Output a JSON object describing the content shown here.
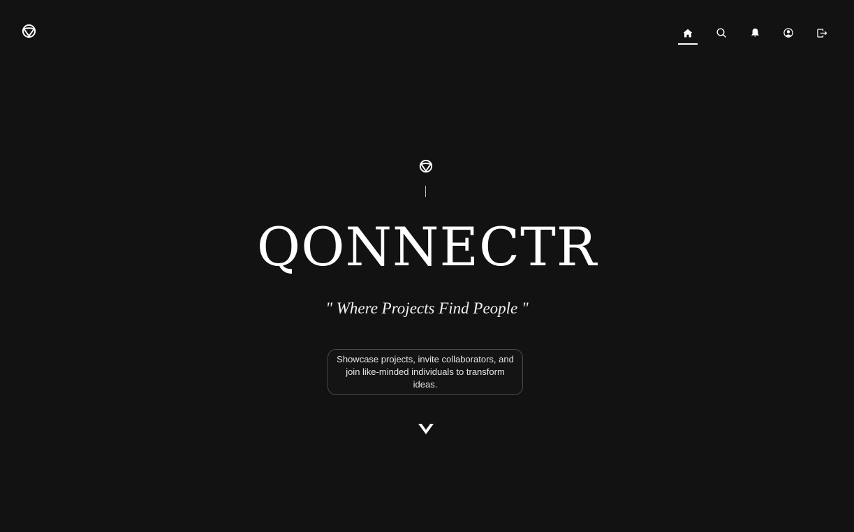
{
  "header": {
    "logo_icon": "qonnectr-logo-icon",
    "nav": [
      {
        "id": "home",
        "icon": "home-icon",
        "active": true
      },
      {
        "id": "search",
        "icon": "search-icon",
        "active": false
      },
      {
        "id": "notifications",
        "icon": "bell-icon",
        "active": false
      },
      {
        "id": "profile",
        "icon": "user-circle-icon",
        "active": false
      },
      {
        "id": "logout",
        "icon": "logout-icon",
        "active": false
      }
    ]
  },
  "hero": {
    "logo_icon": "qonnectr-logo-icon",
    "title": "QONNECTR",
    "tagline": "\" Where Projects Find People \"",
    "description": "Showcase projects, invite collaborators, and join like-minded individuals to transform ideas.",
    "scroll_icon": "chevron-down-icon"
  },
  "colors": {
    "background": "#121212",
    "text": "#ffffff",
    "border": "#4a4a4a"
  }
}
